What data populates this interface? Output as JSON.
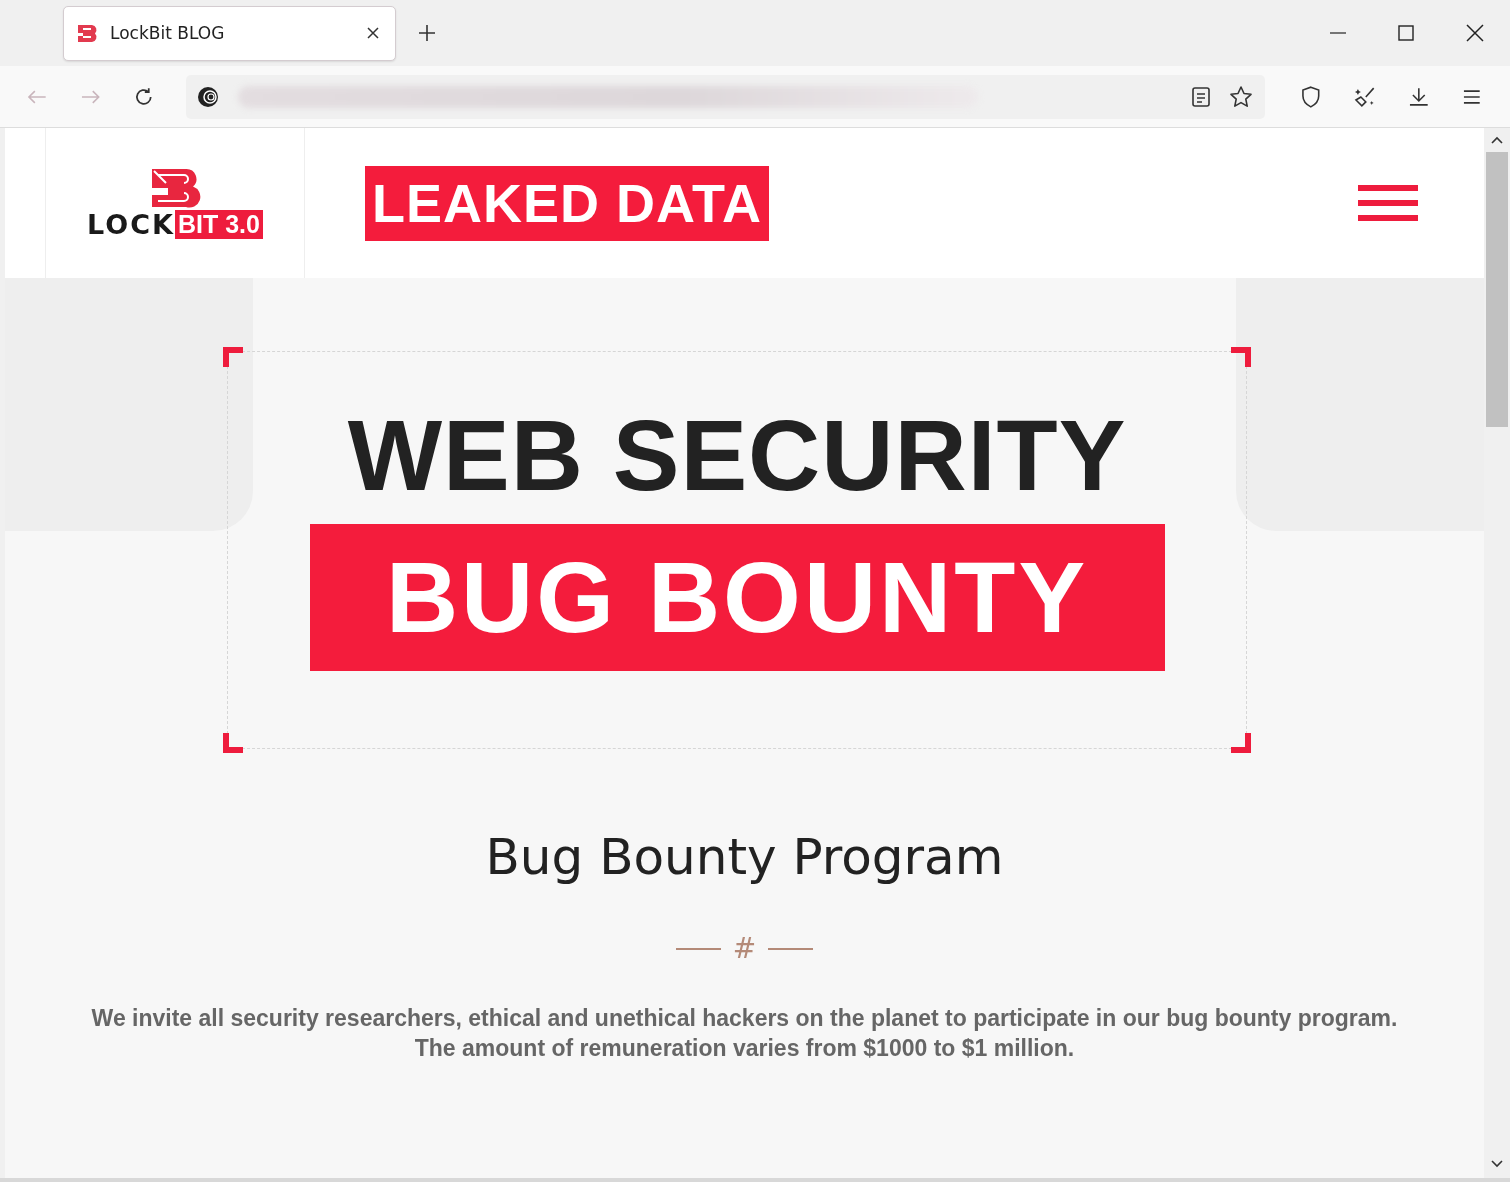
{
  "browser": {
    "tabs": [
      {
        "title": "LockBit BLOG",
        "selected": true
      }
    ]
  },
  "site_header": {
    "logo": {
      "word": "LOCK",
      "badge": "BIT 3.0"
    },
    "banner": "LEAKED DATA"
  },
  "hero": {
    "title": "WEB SECURITY",
    "highlight": "BUG BOUNTY"
  },
  "section": {
    "heading": "Bug Bounty Program",
    "divider_symbol": "#",
    "paragraphs": [
      "We invite all security researchers, ethical and unethical hackers on the planet to participate in our bug bounty program.",
      "The amount of remuneration varies from $1000 to $1 million."
    ]
  }
}
